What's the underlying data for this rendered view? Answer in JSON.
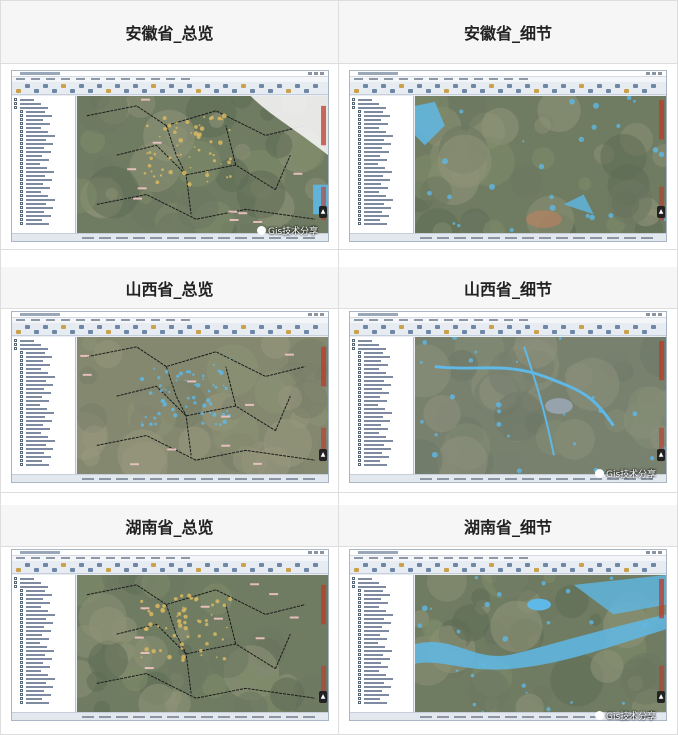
{
  "panels": [
    {
      "title": "安徽省_总览",
      "view": "overview",
      "watermark": "Gis技术分享"
    },
    {
      "title": "安徽省_细节",
      "view": "detail",
      "watermark": ""
    },
    {
      "title": "山西省_总览",
      "view": "overview",
      "watermark": ""
    },
    {
      "title": "山西省_细节",
      "view": "detail",
      "watermark": "Gis技术分享"
    },
    {
      "title": "湖南省_总览",
      "view": "overview",
      "watermark": ""
    },
    {
      "title": "湖南省_细节",
      "view": "detail",
      "watermark": "Gis技术分享"
    }
  ],
  "colors": {
    "header_bg": "#f6f6f6",
    "border": "#dedede",
    "satellite": "#6f7c62",
    "water": "#5fb8e6",
    "urban": "#d9b861",
    "boundary": "#1a1a1a",
    "legend_red": "#c0392b"
  },
  "icons": [
    "scroll-top-icon",
    "watermark-logo-icon"
  ]
}
